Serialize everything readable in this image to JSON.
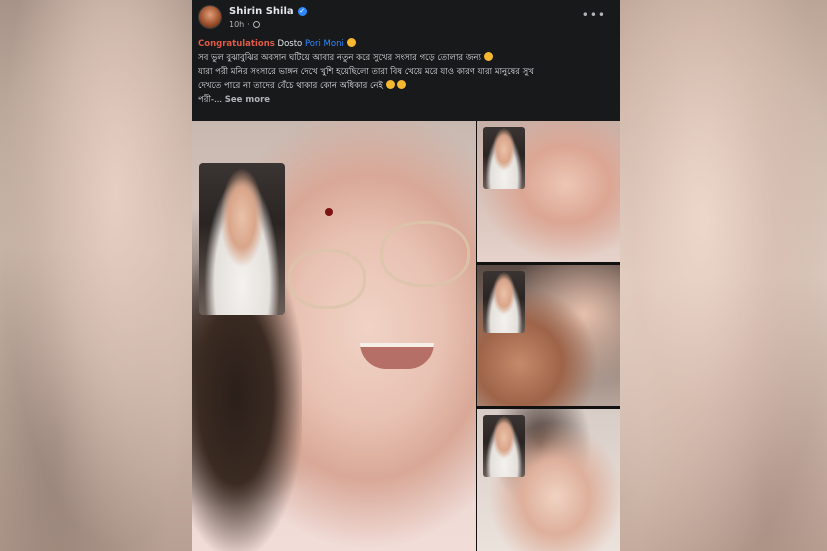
{
  "post": {
    "author": "Shirin Shila",
    "time": "10h",
    "more_menu": "•••",
    "caption": {
      "congrats_label": "Congratulations",
      "dosto_label": "Dosto",
      "tagged_name": "Pori Moni",
      "line1": "সব ভুল বুঝাবুঝির অবসান ঘটিয়ে আবার নতুন করে সুখের সংসার গড়ে তোলার জন্য",
      "line2": "যারা পরী মনির সংসারে ভাঙ্গন দেখে খুশি হয়েছিলো তারা বিষ খেয়ে মরে যাও কারণ যারা মানুষের সুখ",
      "line3": "দেখতে পারে না তাদের বেঁচে থাকার কোন অধিকার নেই",
      "line4_start": "পরী-...",
      "see_more": "See more"
    }
  },
  "icons": {
    "verified": "verified-badge-icon",
    "globe": "globe-icon",
    "more": "more-options-icon"
  },
  "colors": {
    "background": "#18191a",
    "text_primary": "#e4e6eb",
    "text_secondary": "#b0b3b8",
    "link": "#2d88ff",
    "congrats": "#e05a48"
  }
}
